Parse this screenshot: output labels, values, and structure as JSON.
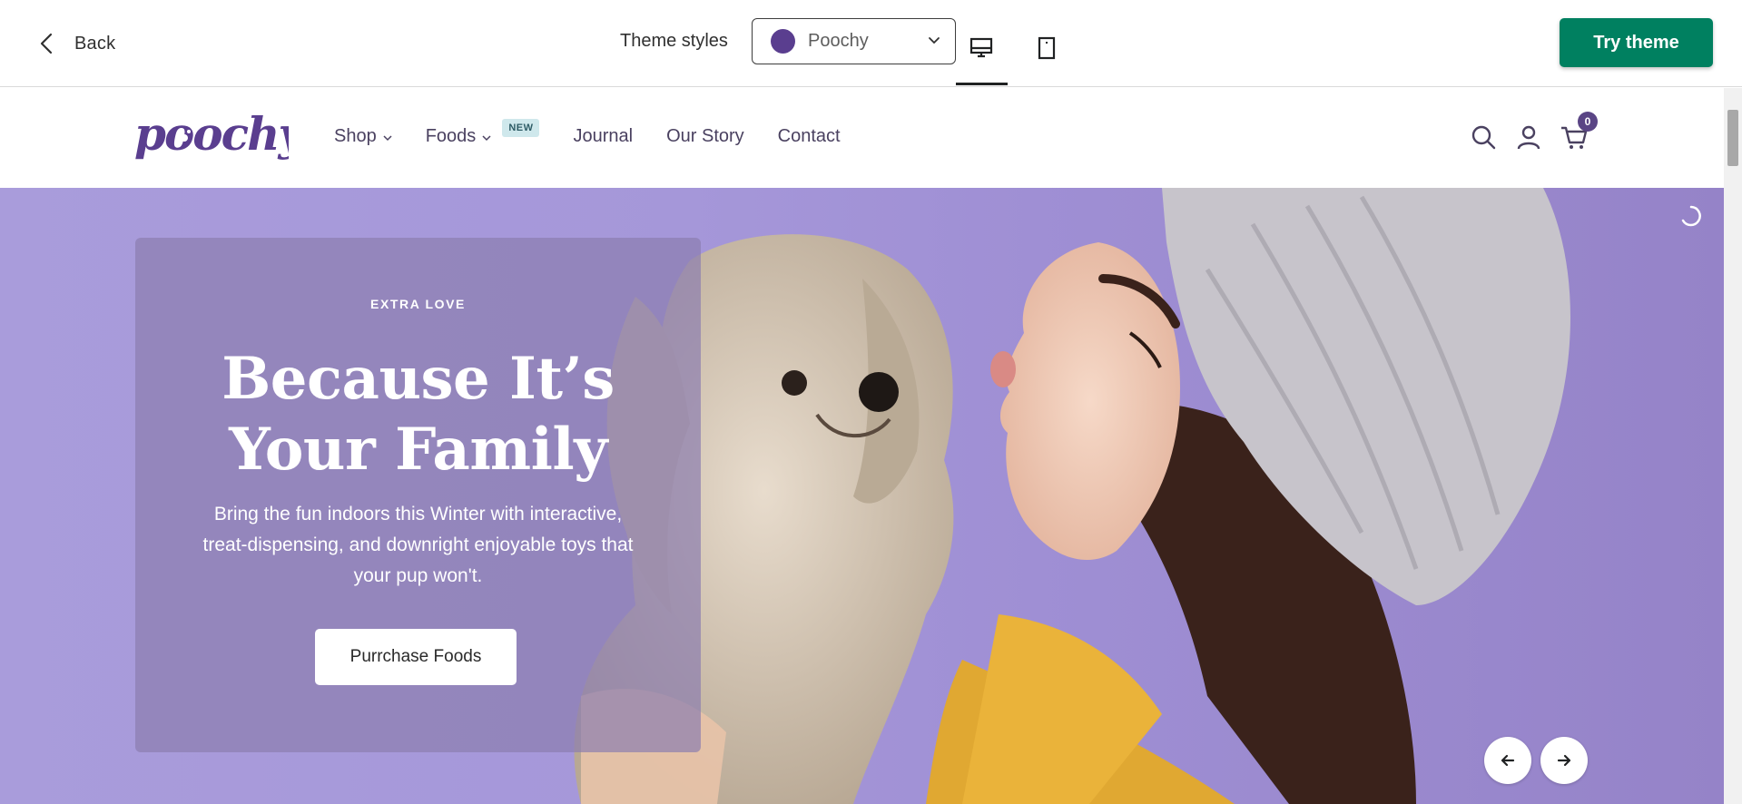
{
  "topbar": {
    "back_label": "Back",
    "theme_styles_label": "Theme styles",
    "style_select": {
      "value": "Poochy",
      "dot_color": "#5a3e8f"
    },
    "devices": [
      "desktop-icon",
      "tablet-icon"
    ],
    "active_device": "desktop",
    "try_label": "Try theme",
    "try_color": "#008060"
  },
  "site": {
    "logo_text": "poochy",
    "nav": [
      {
        "label": "Shop",
        "has_dropdown": true
      },
      {
        "label": "Foods",
        "has_dropdown": true,
        "badge": "NEW"
      },
      {
        "label": "Journal"
      },
      {
        "label": "Our Story"
      },
      {
        "label": "Contact"
      }
    ],
    "icons": [
      "search-icon",
      "account-icon",
      "cart-icon"
    ],
    "cart_count": "0",
    "brand_color": "#5a4585"
  },
  "hero": {
    "eyebrow": "EXTRA LOVE",
    "title": "Because It’s Your Family",
    "text": "Bring the fun indoors this Winter with interactive, treat-dispensing, and downright enjoyable toys that your pup won't.",
    "button_label": "Purrchase Foods",
    "background_color": "#a597d9"
  }
}
